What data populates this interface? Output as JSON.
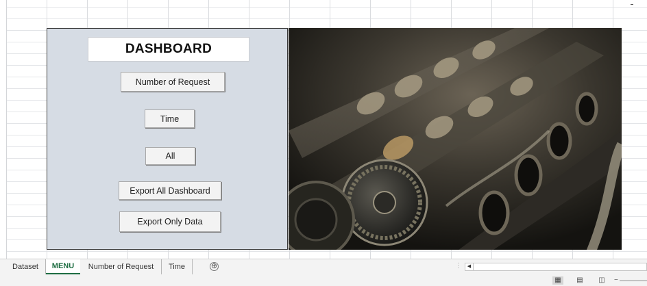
{
  "dashboard": {
    "title": "DASHBOARD",
    "buttons": {
      "number_of_request": "Number of Request",
      "time": "Time",
      "all": "All",
      "export_all_dashboard": "Export All Dashboard",
      "export_only_data": "Export Only Data"
    },
    "panel_color": "#d6dce4"
  },
  "sheet_tabs": [
    {
      "label": "Dataset",
      "active": false
    },
    {
      "label": "MENU",
      "active": true
    },
    {
      "label": "Number of Request",
      "active": false
    },
    {
      "label": "Time",
      "active": false
    }
  ],
  "add_sheet_icon": "⊕",
  "hscroll_left_icon": "◀",
  "status_bar": {
    "view_normal_icon": "▦",
    "view_page_layout_icon": "▤",
    "view_page_break_icon": "◫",
    "zoom_minus": "−"
  },
  "accent_color": "#1f6e43",
  "image": {
    "icon": "engine-photo"
  }
}
